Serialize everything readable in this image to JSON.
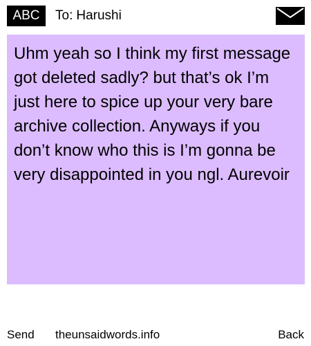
{
  "header": {
    "input_mode": "ABC",
    "to_prefix": "To:",
    "recipient": "Harushi",
    "envelope_icon": "envelope-icon"
  },
  "message": {
    "background_color": "#dcbcff",
    "text": "Uhm yeah so I think my first message got deleted sadly? but that’s ok I’m just here to spice up your very bare archive collection. Anyways if you don’t know who this is I’m gonna be very disappointed in you ngl. Aurevoir"
  },
  "footer": {
    "send_label": "Send",
    "site_label": "theunsaidwords.info",
    "back_label": "Back"
  }
}
